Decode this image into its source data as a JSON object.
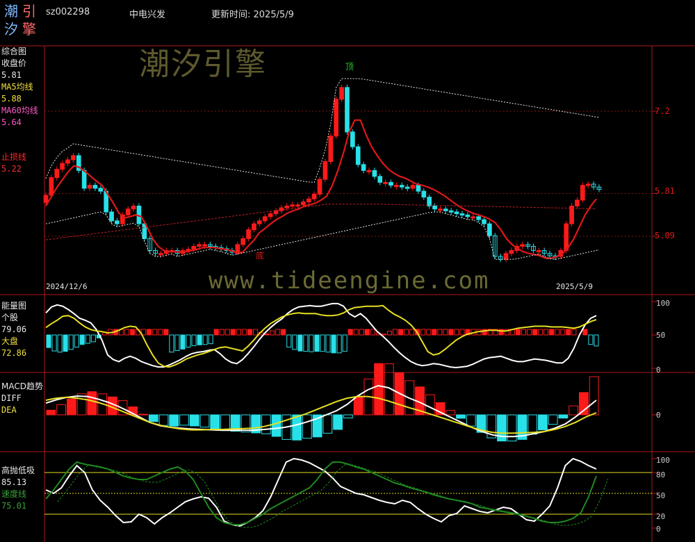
{
  "header": {
    "logo_chars": [
      "潮",
      "引",
      "汐",
      "擎"
    ],
    "code": "sz002298",
    "name": "中电兴发",
    "update_label": "更新时间: 2025/5/9"
  },
  "watermark": {
    "cn": "潮汐引擎",
    "url": "www.tideengine.com"
  },
  "main_panel": {
    "title": "综合图",
    "close_label": "收盘价",
    "close_value": "5.81",
    "ma5_label": "MA5均线",
    "ma5_value": "5.88",
    "ma60_label": "MA60均线",
    "ma60_value": "5.64",
    "stop_label": "止损线",
    "stop_value": "5.22",
    "top_marker": "顶",
    "bottom_marker": "底",
    "date_start": "2024/12/6",
    "date_end": "2025/5/9",
    "axis_labels": [
      "7.2",
      "5.81",
      "5.09"
    ]
  },
  "energy_panel": {
    "title": "能量图",
    "stock_label": "个股",
    "stock_value": "79.06",
    "market_label": "大盘",
    "market_value": "72.86",
    "axis_labels": [
      "100",
      "50",
      "0"
    ]
  },
  "macd_panel": {
    "title": "MACD趋势",
    "diff_label": "DIFF",
    "dea_label": "DEA",
    "axis_labels": [
      "0"
    ]
  },
  "osc_panel": {
    "title": "高抛低吸",
    "value1": "85.13",
    "speed_label": "速度线",
    "value2": "75.01",
    "axis_labels": [
      "100",
      "80",
      "50",
      "20",
      "0"
    ]
  },
  "colors": {
    "up": "#ff1a1a",
    "down": "#28e0e8",
    "ma": "#e01818",
    "divider": "#b01818",
    "energy_stock": "#ffffff",
    "energy_market": "#e8e020",
    "diff": "#ffffff",
    "dea": "#e8e020",
    "osc_fast": "#ffffff",
    "osc_speed": "#1f8a1f"
  },
  "chart_data": [
    {
      "type": "candlestick",
      "title": "综合图",
      "x_start": "2024/12/6",
      "x_end": "2025/5/9",
      "y_ticks": [
        7.2,
        5.81,
        5.09
      ],
      "closes": [
        5.78,
        6.08,
        6.22,
        6.32,
        6.38,
        6.45,
        6.2,
        5.9,
        5.95,
        5.9,
        5.85,
        5.5,
        5.35,
        5.3,
        5.45,
        5.55,
        5.6,
        5.3,
        5.05,
        4.85,
        4.8,
        4.8,
        4.85,
        4.85,
        4.8,
        4.85,
        4.87,
        4.92,
        4.95,
        4.95,
        4.92,
        4.9,
        4.88,
        4.85,
        4.82,
        4.95,
        5.05,
        5.2,
        5.3,
        5.35,
        5.42,
        5.47,
        5.52,
        5.57,
        5.6,
        5.62,
        5.62,
        5.67,
        5.72,
        5.8,
        6.05,
        6.35,
        6.78,
        7.4,
        7.6,
        6.85,
        6.6,
        6.3,
        6.2,
        6.2,
        6.1,
        6.0,
        6.0,
        5.95,
        5.95,
        5.92,
        5.9,
        5.95,
        5.85,
        5.75,
        5.6,
        5.55,
        5.55,
        5.52,
        5.5,
        5.47,
        5.45,
        5.42,
        5.42,
        5.37,
        5.3,
        5.1,
        4.75,
        4.7,
        4.8,
        4.85,
        4.92,
        4.95,
        4.92,
        4.85,
        4.85,
        4.8,
        4.76,
        4.75,
        4.85,
        5.3,
        5.6,
        5.7,
        5.95,
        5.97,
        5.92,
        5.88
      ],
      "ma5": [
        5.6,
        5.76,
        5.92,
        6.05,
        6.18,
        6.28,
        6.25,
        6.18,
        6.1,
        6.02,
        5.95,
        5.8,
        5.65,
        5.48,
        5.4,
        5.42,
        5.45,
        5.42,
        5.25,
        5.05,
        4.92,
        4.85,
        4.83,
        4.83,
        4.82,
        4.83,
        4.85,
        4.87,
        4.9,
        4.9,
        4.9,
        4.88,
        4.87,
        4.85,
        4.8,
        4.82,
        4.92,
        5.02,
        5.15,
        5.22,
        5.3,
        5.37,
        5.42,
        5.48,
        5.52,
        5.55,
        5.6,
        5.62,
        5.65,
        5.7,
        5.77,
        5.95,
        6.2,
        6.5,
        6.85,
        7.05,
        7.05,
        6.8,
        6.6,
        6.45,
        6.32,
        6.22,
        6.15,
        6.1,
        6.07,
        6.02,
        5.97,
        5.95,
        5.92,
        5.88,
        5.83,
        5.77,
        5.7,
        5.63,
        5.57,
        5.52,
        5.48,
        5.45,
        5.42,
        5.38,
        5.32,
        5.2,
        5.05,
        4.95,
        4.88,
        4.83,
        4.8,
        4.78,
        4.76,
        4.72,
        4.72,
        4.75,
        4.8,
        4.9,
        5.05,
        5.25,
        5.45,
        5.6,
        5.72
      ],
      "ma60_visible": true,
      "stop_line_visible": true
    },
    {
      "type": "line",
      "title": "能量图",
      "ylim": [
        0,
        100
      ],
      "y_ticks": [
        100,
        50,
        0
      ],
      "series": [
        {
          "name": "个股",
          "values": [
            83,
            92,
            95,
            93,
            88,
            82,
            75,
            72,
            68,
            58,
            42,
            20,
            13,
            10,
            15,
            18,
            15,
            10,
            7,
            4,
            2,
            2,
            5,
            9,
            13,
            18,
            22,
            24,
            25,
            27,
            28,
            22,
            14,
            9,
            7,
            13,
            22,
            32,
            43,
            53,
            61,
            68,
            74,
            82,
            88,
            92,
            93,
            94,
            93,
            93,
            95,
            97,
            97,
            93,
            82,
            77,
            82,
            75,
            65,
            55,
            48,
            40,
            31,
            23,
            16,
            10,
            6,
            4,
            5,
            7,
            6,
            4,
            2,
            1,
            2,
            3,
            6,
            10,
            14,
            16,
            17,
            18,
            15,
            12,
            10,
            10,
            12,
            14,
            13,
            12,
            10,
            8,
            8,
            15,
            30,
            50,
            65,
            75,
            79
          ]
        },
        {
          "name": "大盘",
          "values": [
            61,
            67,
            72,
            78,
            79,
            75,
            68,
            62,
            58,
            56,
            55,
            53,
            54,
            57,
            61,
            63,
            62,
            52,
            35,
            20,
            8,
            3,
            2,
            5,
            9,
            14,
            17,
            20,
            22,
            25,
            28,
            31,
            32,
            30,
            28,
            26,
            33,
            42,
            52,
            60,
            67,
            72,
            77,
            80,
            82,
            83,
            82,
            82,
            82,
            80,
            79,
            79,
            80,
            83,
            88,
            91,
            92,
            93,
            93,
            93,
            94,
            87,
            81,
            77,
            72,
            65,
            55,
            40,
            25,
            20,
            22,
            28,
            35,
            42,
            47,
            51,
            53,
            55,
            56,
            57,
            57,
            56,
            56,
            58,
            60,
            61,
            62,
            63,
            63,
            63,
            62,
            62,
            62,
            61,
            60,
            62,
            66,
            70,
            73
          ]
        }
      ]
    },
    {
      "type": "line",
      "title": "MACD趋势",
      "y_ticks": [
        0
      ],
      "series": [
        {
          "name": "DIFF",
          "values": [
            0.28,
            0.36,
            0.42,
            0.45,
            0.44,
            0.38,
            0.3,
            0.2,
            0.08,
            -0.05,
            -0.18,
            -0.26,
            -0.3,
            -0.32,
            -0.34,
            -0.35,
            -0.36,
            -0.37,
            -0.37,
            -0.37,
            -0.37,
            -0.35,
            -0.33,
            -0.3,
            -0.25,
            -0.18,
            -0.1,
            0.0,
            0.1,
            0.25,
            0.45,
            0.6,
            0.7,
            0.65,
            0.52,
            0.4,
            0.3,
            0.18,
            0.06,
            -0.06,
            -0.18,
            -0.3,
            -0.4,
            -0.48,
            -0.52,
            -0.52,
            -0.5,
            -0.45,
            -0.4,
            -0.32,
            -0.22,
            -0.05,
            0.15,
            0.35
          ]
        },
        {
          "name": "DEA",
          "values": [
            0.35,
            0.4,
            0.42,
            0.4,
            0.36,
            0.3,
            0.22,
            0.12,
            0.02,
            -0.08,
            -0.18,
            -0.25,
            -0.3,
            -0.34,
            -0.36,
            -0.36,
            -0.35,
            -0.35,
            -0.34,
            -0.33,
            -0.32,
            -0.28,
            -0.22,
            -0.14,
            -0.06,
            0.02,
            0.12,
            0.22,
            0.32,
            0.4,
            0.44,
            0.44,
            0.4,
            0.33,
            0.25,
            0.17,
            0.1,
            0.02,
            -0.06,
            -0.14,
            -0.22,
            -0.3,
            -0.37,
            -0.42,
            -0.44,
            -0.44,
            -0.43,
            -0.42,
            -0.4,
            -0.35,
            -0.28,
            -0.18,
            -0.05,
            0.05
          ]
        }
      ]
    },
    {
      "type": "line",
      "title": "高抛低吸",
      "ylim": [
        0,
        100
      ],
      "y_ticks": [
        100,
        80,
        50,
        20,
        0
      ],
      "series": [
        {
          "name": "高抛低吸",
          "values": [
            55,
            50,
            58,
            75,
            90,
            80,
            55,
            40,
            30,
            18,
            8,
            9,
            20,
            15,
            6,
            15,
            22,
            30,
            38,
            42,
            45,
            43,
            30,
            10,
            5,
            3,
            8,
            15,
            25,
            45,
            70,
            95,
            100,
            98,
            94,
            88,
            82,
            72,
            60,
            55,
            50,
            48,
            44,
            40,
            37,
            35,
            40,
            37,
            28,
            20,
            14,
            9,
            18,
            21,
            32,
            28,
            24,
            22,
            26,
            30,
            28,
            20,
            12,
            10,
            20,
            32,
            58,
            90,
            100,
            96,
            90,
            85
          ]
        },
        {
          "name": "速度线",
          "values": [
            42,
            55,
            70,
            85,
            95,
            92,
            90,
            88,
            85,
            80,
            75,
            72,
            70,
            70,
            75,
            80,
            85,
            88,
            82,
            70,
            50,
            30,
            15,
            8,
            5,
            5,
            8,
            14,
            20,
            28,
            34,
            40,
            46,
            52,
            58,
            70,
            85,
            95,
            95,
            92,
            88,
            85,
            80,
            75,
            70,
            65,
            62,
            58,
            55,
            52,
            48,
            45,
            42,
            40,
            38,
            35,
            30,
            28,
            26,
            24,
            22,
            20,
            17,
            14,
            10,
            8,
            8,
            10,
            14,
            22,
            45,
            75
          ]
        }
      ]
    }
  ]
}
